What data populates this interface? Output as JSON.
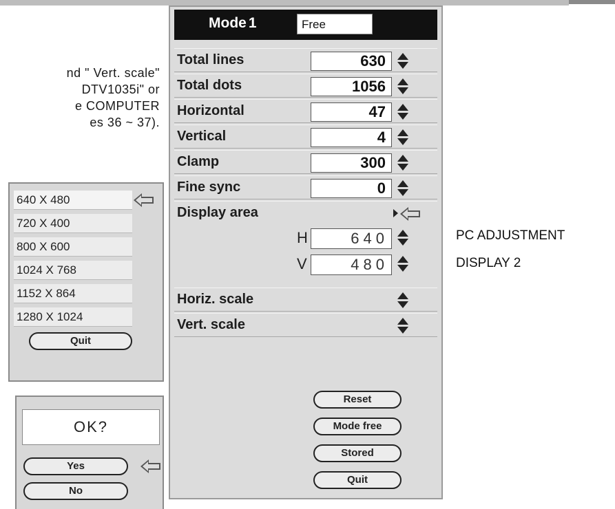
{
  "manual_text": [
    "nd \" Vert. scale\"",
    "DTV1035i\"  or",
    "e COMPUTER",
    "es 36 ~ 37)."
  ],
  "menu": {
    "mode_label": "Mode",
    "mode_number": "1",
    "mode_value": "Free",
    "rows": [
      {
        "label": "Total lines",
        "value": "630"
      },
      {
        "label": "Total dots",
        "value": "1056"
      },
      {
        "label": "Horizontal",
        "value": "47"
      },
      {
        "label": "Vertical",
        "value": "4"
      },
      {
        "label": "Clamp",
        "value": "300"
      },
      {
        "label": "Fine sync",
        "value": "0"
      }
    ],
    "display_area": {
      "label": "Display area",
      "h_letter": "H",
      "h_value": "640",
      "v_letter": "V",
      "v_value": "480"
    },
    "horiz_scale": "Horiz. scale",
    "vert_scale": "Vert. scale",
    "buttons": {
      "reset": "Reset",
      "mode_free": "Mode free",
      "stored": "Stored",
      "quit": "Quit"
    }
  },
  "side_labels": {
    "line1": "PC ADJUSTMENT",
    "line2": "DISPLAY 2"
  },
  "resolution_panel": {
    "items": [
      "640 X 480",
      "720 X 400",
      "800 X 600",
      "1024 X 768",
      "1152 X 864",
      "1280 X 1024"
    ],
    "selected_index": 0,
    "quit": "Quit"
  },
  "ok_panel": {
    "prompt": "OK?",
    "yes": "Yes",
    "no": "No"
  }
}
